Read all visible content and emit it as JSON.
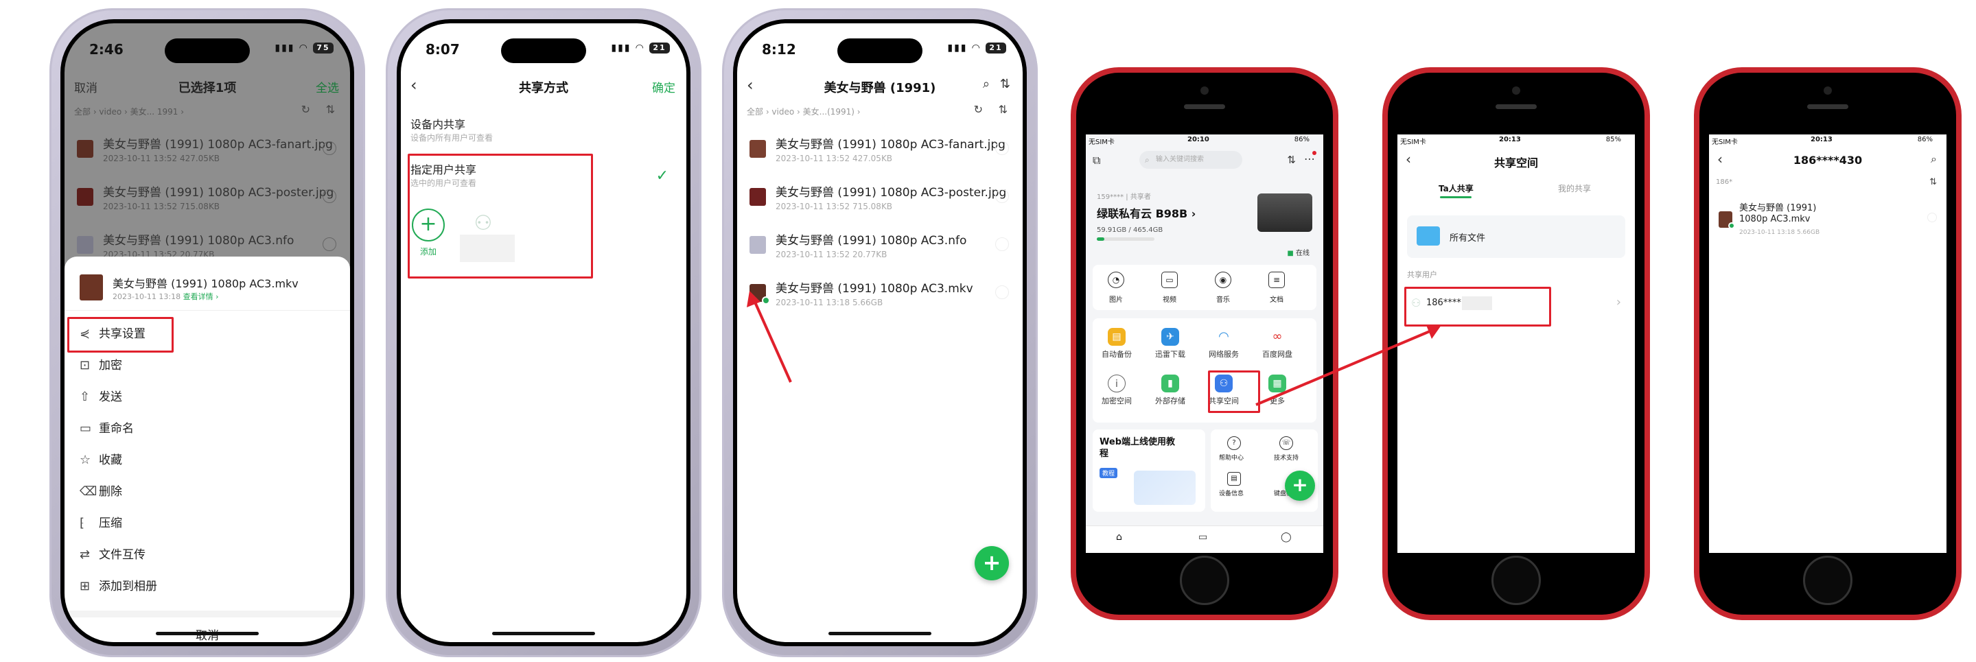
{
  "phone1": {
    "time": "2:46",
    "battery": "75",
    "header": {
      "cancel": "取消",
      "title": "已选择1项",
      "select_all": "全选"
    },
    "breadcrumb": "全部 › video › 美女... 1991 ›",
    "files": [
      {
        "name": "美女与野兽 (1991) 1080p AC3-fanart.jpg",
        "meta": "2023-10-11 13:52  427.05KB"
      },
      {
        "name": "美女与野兽 (1991) 1080p AC3-poster.jpg",
        "meta": "2023-10-11 13:52  715.08KB"
      },
      {
        "name": "美女与野兽 (1991) 1080p AC3.nfo",
        "meta": "2023-10-11 13:52  20.77KB"
      }
    ],
    "sheet": {
      "file_name": "美女与野兽 (1991) 1080p AC3.mkv",
      "file_meta": "2023-10-11 13:18",
      "details_link": "查看详情 ›",
      "items": [
        "共享设置",
        "加密",
        "发送",
        "重命名",
        "收藏",
        "删除",
        "压缩",
        "文件互传",
        "添加到相册"
      ],
      "cancel": "取消"
    }
  },
  "phone2": {
    "time": "8:07",
    "battery": "21",
    "header": {
      "title": "共享方式",
      "confirm": "确定"
    },
    "option1": {
      "title": "设备内共享",
      "desc": "设备内所有用户可查看"
    },
    "option2": {
      "title": "指定用户共享",
      "desc": "选中的用户可查看"
    },
    "add_label": "添加"
  },
  "phone3": {
    "time": "8:12",
    "battery": "21",
    "header": {
      "title": "美女与野兽 (1991)"
    },
    "breadcrumb": "全部 › video › 美女...(1991) ›",
    "files": [
      {
        "name": "美女与野兽 (1991) 1080p AC3-fanart.jpg",
        "meta": "2023-10-11 13:52  427.05KB"
      },
      {
        "name": "美女与野兽 (1991) 1080p AC3-poster.jpg",
        "meta": "2023-10-11 13:52  715.08KB"
      },
      {
        "name": "美女与野兽 (1991) 1080p AC3.nfo",
        "meta": "2023-10-11 13:52  20.77KB"
      },
      {
        "name": "美女与野兽 (1991) 1080p AC3.mkv",
        "meta": "2023-10-11 13:18  5.66GB"
      }
    ]
  },
  "phone4": {
    "status": {
      "carrier": "无SIM卡",
      "time": "20:10",
      "battery": "86%"
    },
    "search_placeholder": "输入关键词搜索",
    "device": {
      "account": "159****",
      "role": "共享者",
      "name": "绿联私有云 B98B ›",
      "storage": "59.91GB / 465.4GB",
      "online": "在线",
      "storage_fraction": 0.13
    },
    "quick": [
      "图片",
      "视频",
      "音乐",
      "文档"
    ],
    "apps": [
      "自动备份",
      "迅雷下载",
      "网络服务",
      "百度网盘",
      "加密空间",
      "外部存储",
      "共享空间",
      "更多"
    ],
    "banner": {
      "title": "Web端上线使用教程",
      "tag": "教程"
    },
    "help": [
      "帮助中心",
      "技术支持",
      "设备信息",
      "键盘模式"
    ]
  },
  "phone5": {
    "status": {
      "carrier": "无SIM卡",
      "time": "20:13",
      "battery": "85%"
    },
    "title": "共享空间",
    "tabs": [
      "Ta人共享",
      "我的共享"
    ],
    "all_files": "所有文件",
    "section": "共享用户",
    "user": "186****"
  },
  "phone6": {
    "status": {
      "carrier": "无SIM卡",
      "time": "20:13",
      "battery": "86%"
    },
    "title": "186****430",
    "breadcrumb": "186*",
    "file": {
      "name": "美女与野兽 (1991) 1080p AC3.mkv",
      "meta": "2023-10-11 13:18  5.66GB"
    }
  }
}
